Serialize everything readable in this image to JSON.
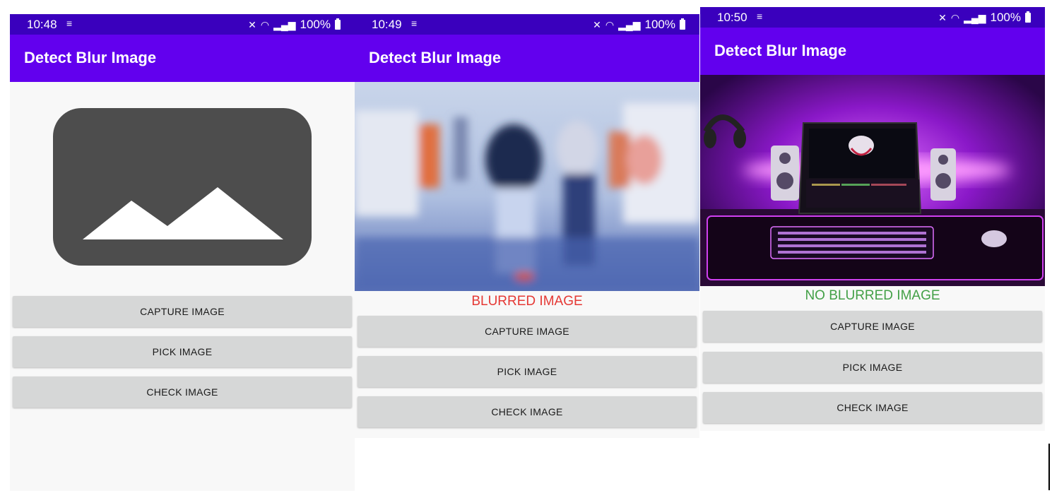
{
  "screens": [
    {
      "status": {
        "time": "10:48",
        "battery": "100%"
      },
      "title": "Detect Blur Image",
      "result": "",
      "buttons": [
        "CAPTURE IMAGE",
        "PICK IMAGE",
        "CHECK IMAGE"
      ],
      "image": "placeholder-image-icon"
    },
    {
      "status": {
        "time": "10:49",
        "battery": "100%"
      },
      "title": "Detect Blur Image",
      "result": "BLURRED IMAGE",
      "buttons": [
        "CAPTURE IMAGE",
        "PICK IMAGE",
        "CHECK IMAGE"
      ],
      "image": "blurred-street-photo"
    },
    {
      "status": {
        "time": "10:50",
        "battery": "100%"
      },
      "title": "Detect Blur Image",
      "result": "NO BLURRED IMAGE",
      "buttons": [
        "CAPTURE IMAGE",
        "PICK IMAGE",
        "CHECK IMAGE"
      ],
      "image": "gaming-desk-photo"
    }
  ],
  "colors": {
    "status_bar": "#3a00bd",
    "app_bar": "#6200ee",
    "blurred_text": "#e53935",
    "not_blurred_text": "#43a047",
    "button_bg": "#d6d7d7"
  }
}
